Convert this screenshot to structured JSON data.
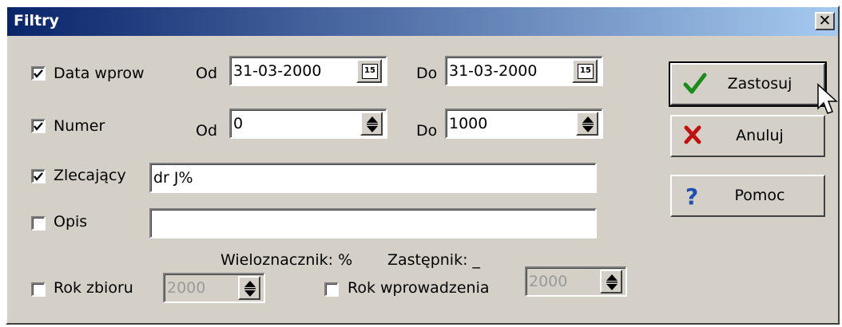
{
  "window": {
    "title": "Filtry",
    "close_glyph": "✕"
  },
  "rows": {
    "data_wprow": {
      "label": "Data wprow",
      "checked": true,
      "od_label": "Od",
      "od_value": "31-03-2000",
      "do_label": "Do",
      "do_value": "31-03-2000",
      "calendar_icon": "15"
    },
    "numer": {
      "label": "Numer",
      "checked": true,
      "od_label": "Od",
      "od_value": "0",
      "do_label": "Do",
      "do_value": "1000"
    },
    "zlecajacy": {
      "label": "Zlecający",
      "checked": true,
      "value": "dr J%"
    },
    "opis": {
      "label": "Opis",
      "checked": false,
      "value": ""
    }
  },
  "hint": {
    "wildcard": "Wieloznacznik: %",
    "placeholder": "Zastępnik: _"
  },
  "rok_zbioru": {
    "label": "Rok zbioru",
    "checked": false,
    "value": "2000"
  },
  "rok_wprowadzenia": {
    "label": "Rok wprowadzenia",
    "checked": false,
    "value": "2000"
  },
  "buttons": {
    "apply": {
      "label": "Zastosuj",
      "icon": "checkmark-icon"
    },
    "cancel": {
      "label": "Anuluj",
      "icon": "red-x-icon"
    },
    "help": {
      "label": "Pomoc",
      "icon": "question-icon"
    }
  },
  "colors": {
    "titlebar_start": "#0a246a",
    "titlebar_end": "#a6caf0",
    "face": "#d4d0c8"
  }
}
